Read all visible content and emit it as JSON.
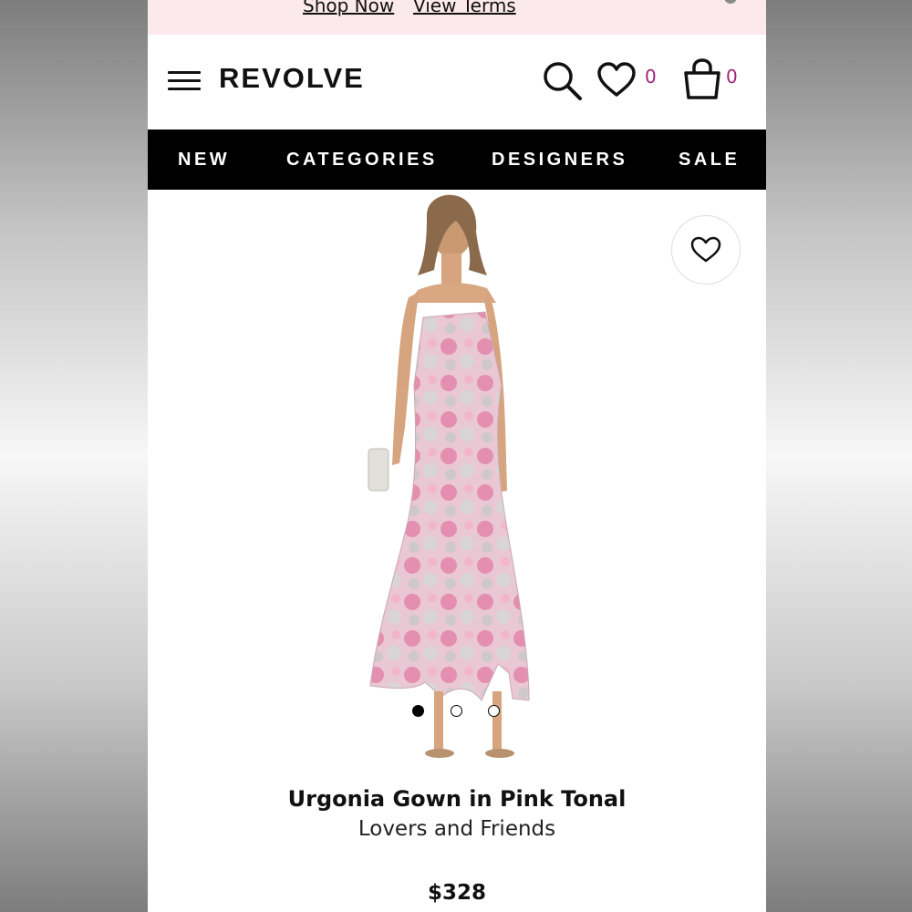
{
  "promo": {
    "shop_now": "Shop Now",
    "view_terms": "View Terms"
  },
  "header": {
    "logo": "REVOLVE",
    "wishlist_count": "0",
    "bag_count": "0"
  },
  "nav": {
    "items": [
      "NEW",
      "CATEGORIES",
      "DESIGNERS",
      "SALE"
    ]
  },
  "product": {
    "name": "Urgonia Gown in Pink Tonal",
    "brand": "Lovers and Friends",
    "price": "$328",
    "image_count": 3,
    "active_image": 1
  },
  "colors": {
    "promo_bg": "#fbe9ec",
    "nav_bg": "#000000",
    "count_accent": "#a0267a"
  },
  "icons": [
    "menu-icon",
    "search-icon",
    "heart-icon",
    "bag-icon",
    "heart-outline-icon"
  ]
}
